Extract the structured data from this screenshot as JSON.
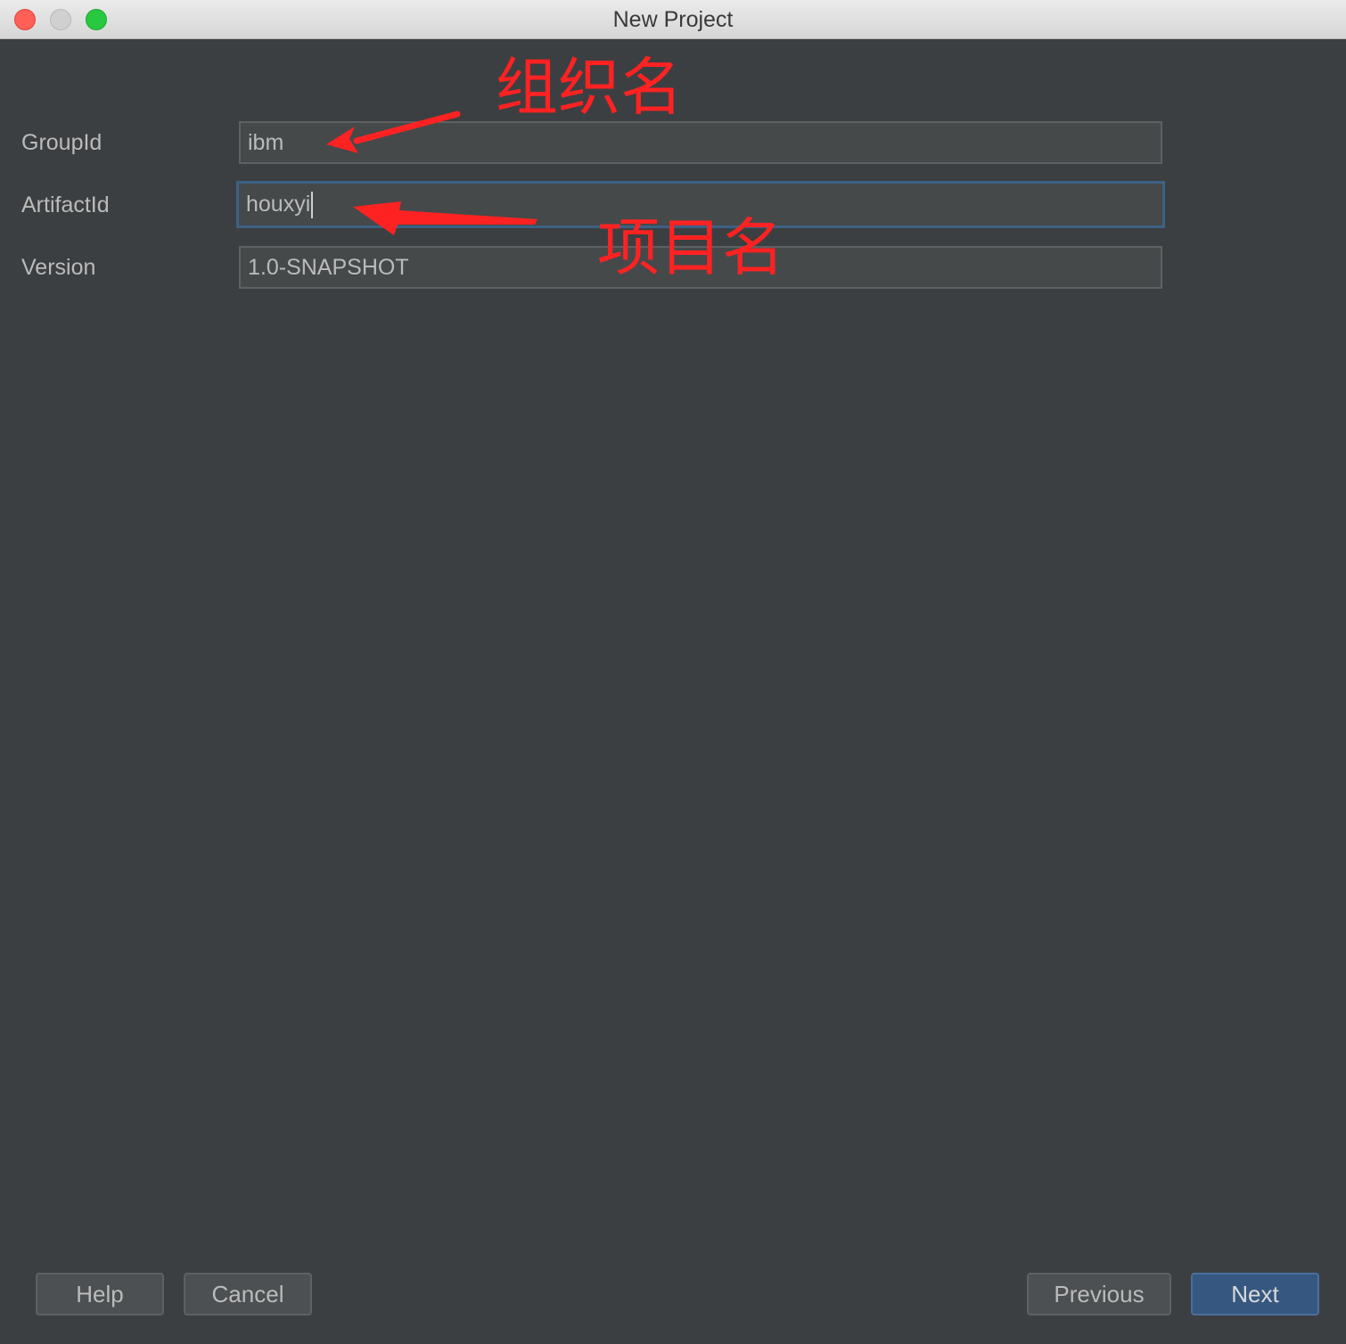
{
  "window": {
    "title": "New Project"
  },
  "form": {
    "group_id": {
      "label": "GroupId",
      "value": "ibm"
    },
    "artifact_id": {
      "label": "ArtifactId",
      "value": "houxyi"
    },
    "version": {
      "label": "Version",
      "value": "1.0-SNAPSHOT"
    }
  },
  "annotations": {
    "group_note": "组织名",
    "artifact_note": "项目名",
    "color": "#ff2222"
  },
  "buttons": {
    "help": "Help",
    "cancel": "Cancel",
    "previous": "Previous",
    "next": "Next"
  },
  "colors": {
    "background": "#3c3f41",
    "field_bg": "#45494a",
    "focus_border": "#3d6185",
    "primary_button": "#365880"
  }
}
